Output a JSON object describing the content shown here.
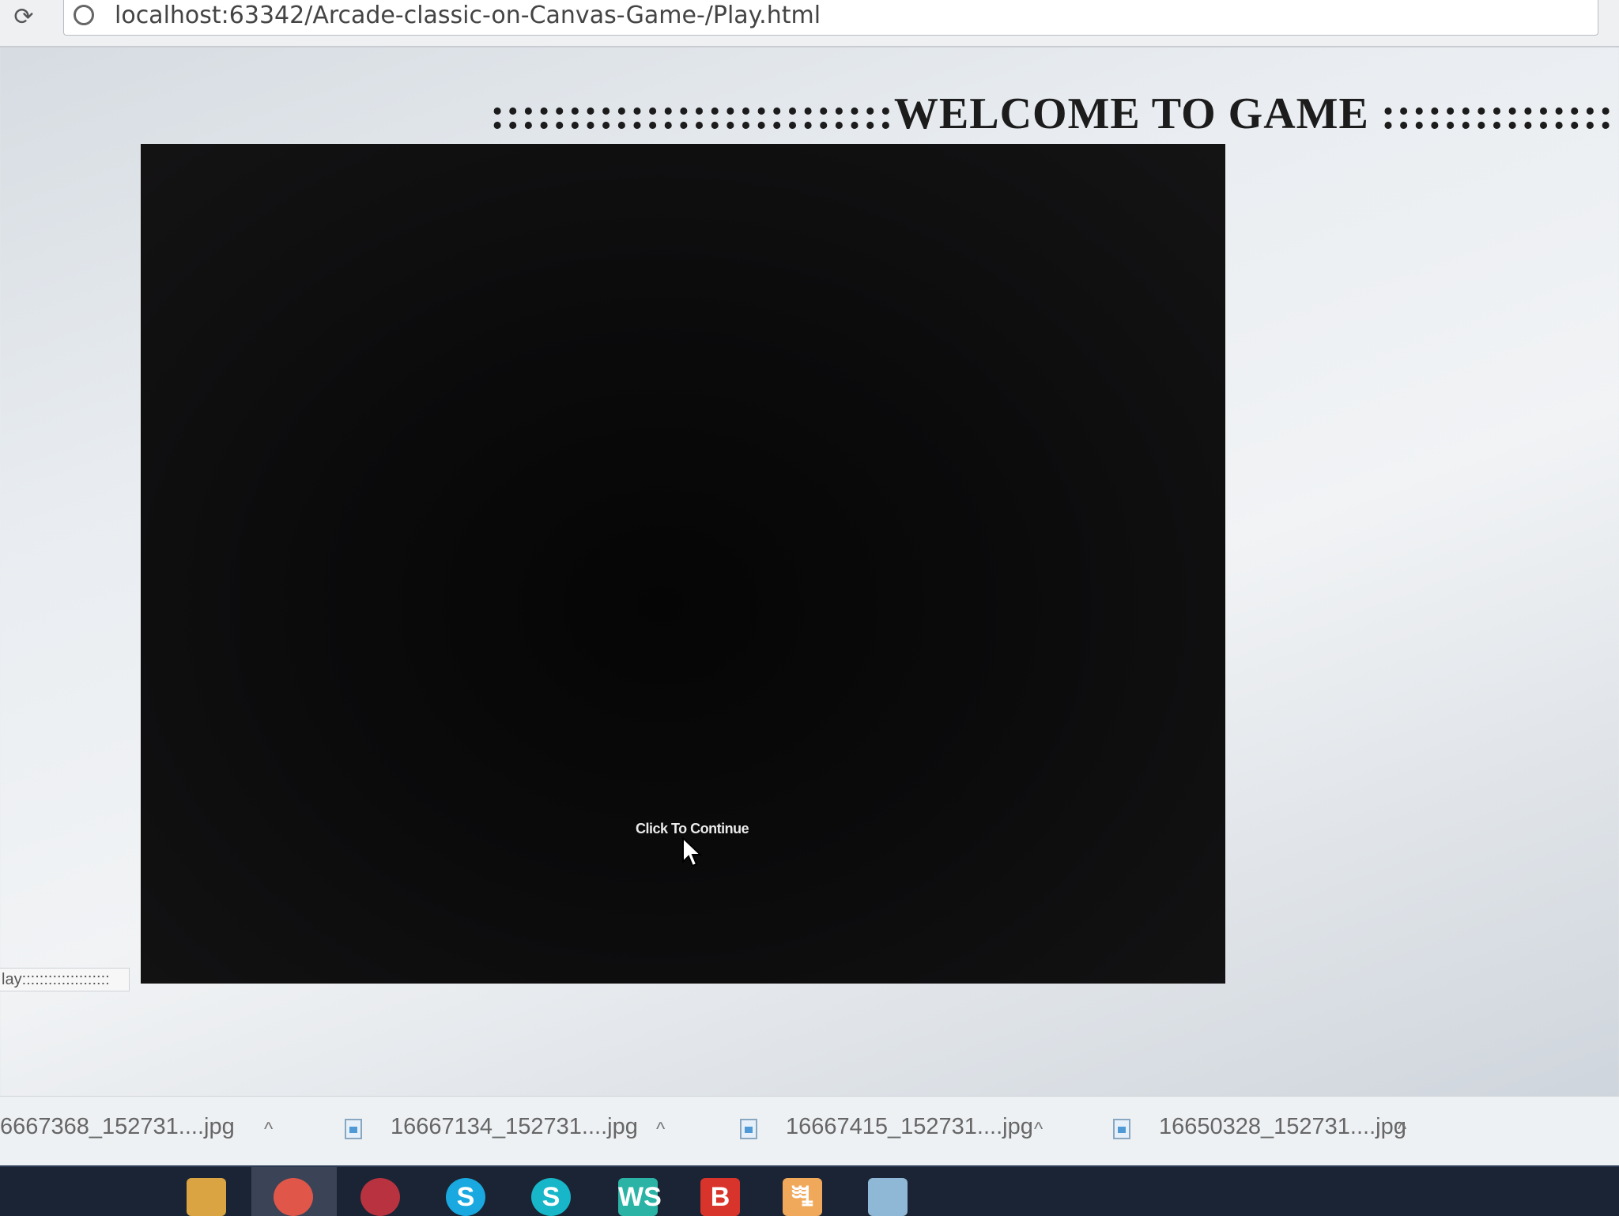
{
  "browser": {
    "back_symbol": "⟳",
    "url": "localhost:63342/Arcade-classic-on-Canvas-Game-/Play.html"
  },
  "page": {
    "title": "::::::::::::::::::::::::::WELCOME TO GAME ::::::::::::::::::::::::::::::::",
    "side_input_value": "lay::::::::::::::::::::"
  },
  "canvas": {
    "continue_text": "Click To Continue"
  },
  "downloads": {
    "items": [
      {
        "name": "6667368_152731....jpg"
      },
      {
        "name": "16667134_152731....jpg"
      },
      {
        "name": "16667415_152731....jpg"
      },
      {
        "name": "16650328_152731....jpg"
      }
    ],
    "chevron": "^"
  },
  "taskbar": {
    "icons": [
      {
        "name": "file-explorer-icon",
        "label": "",
        "color": "#d9a441"
      },
      {
        "name": "chrome-icon",
        "label": "",
        "color": "#e0574a"
      },
      {
        "name": "app-red-circle-icon",
        "label": "",
        "color": "#b8333f"
      },
      {
        "name": "skype-icon",
        "label": "S",
        "color": "#19a9e0"
      },
      {
        "name": "skype-business-icon",
        "label": "S",
        "color": "#17b6c8"
      },
      {
        "name": "webstorm-icon",
        "label": "WS",
        "color": "#2bb3a5"
      },
      {
        "name": "brackets-icon",
        "label": "B",
        "color": "#d8342b"
      },
      {
        "name": "xampp-icon",
        "label": "ꗀ",
        "color": "#f0a85a"
      },
      {
        "name": "mysql-dolphin-icon",
        "label": "",
        "color": "#8fb7d6"
      }
    ]
  }
}
